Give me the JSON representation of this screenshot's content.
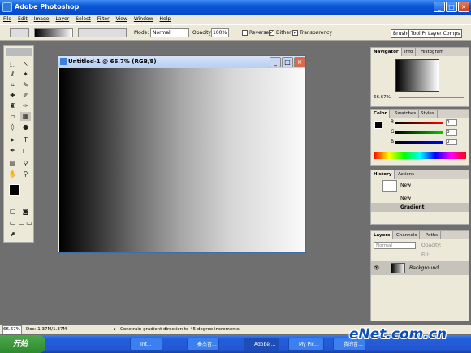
{
  "app": {
    "title": "Adobe Photoshop"
  },
  "menu": [
    "File",
    "Edit",
    "Image",
    "Layer",
    "Select",
    "Filter",
    "View",
    "Window",
    "Help"
  ],
  "options": {
    "mode_label": "Mode:",
    "mode_value": "Normal",
    "opacity_label": "Opacity:",
    "opacity_value": "100%",
    "reverse": "Reverse",
    "dither": "Dither",
    "transparency": "Transparency"
  },
  "wells": [
    "Brushes",
    "Tool Pre",
    "Layer Comps"
  ],
  "document": {
    "title": "Untitled-1 @ 66.7% (RGB/8)"
  },
  "navigator": {
    "tabs": [
      "Navigator",
      "Info",
      "Histogram"
    ],
    "zoom": "66.67%"
  },
  "color": {
    "tabs": [
      "Color",
      "Swatches",
      "Styles"
    ],
    "r": "R",
    "g": "G",
    "b": "B",
    "r_val": "0",
    "g_val": "0",
    "b_val": "0"
  },
  "history": {
    "tabs": [
      "History",
      "Actions"
    ],
    "snapshot": "New",
    "items": [
      "New",
      "Gradient"
    ]
  },
  "layers": {
    "tabs": [
      "Layers",
      "Channels",
      "Paths"
    ],
    "mode": "Normal",
    "opacity_label": "Opacity:",
    "fill_label": "Fill:",
    "layer": "Background"
  },
  "status": {
    "zoom": "66.67%",
    "doc": "Doc: 1.37M/1.37M",
    "hint": "Constrain gradient direction to 45 degree increments."
  },
  "taskbar": {
    "start": "开始",
    "items": [
      "Int...",
      "秦杰音...",
      "Adobe ...",
      "My Pic...",
      "我的音..."
    ]
  },
  "watermark": "eNet.com.cn"
}
